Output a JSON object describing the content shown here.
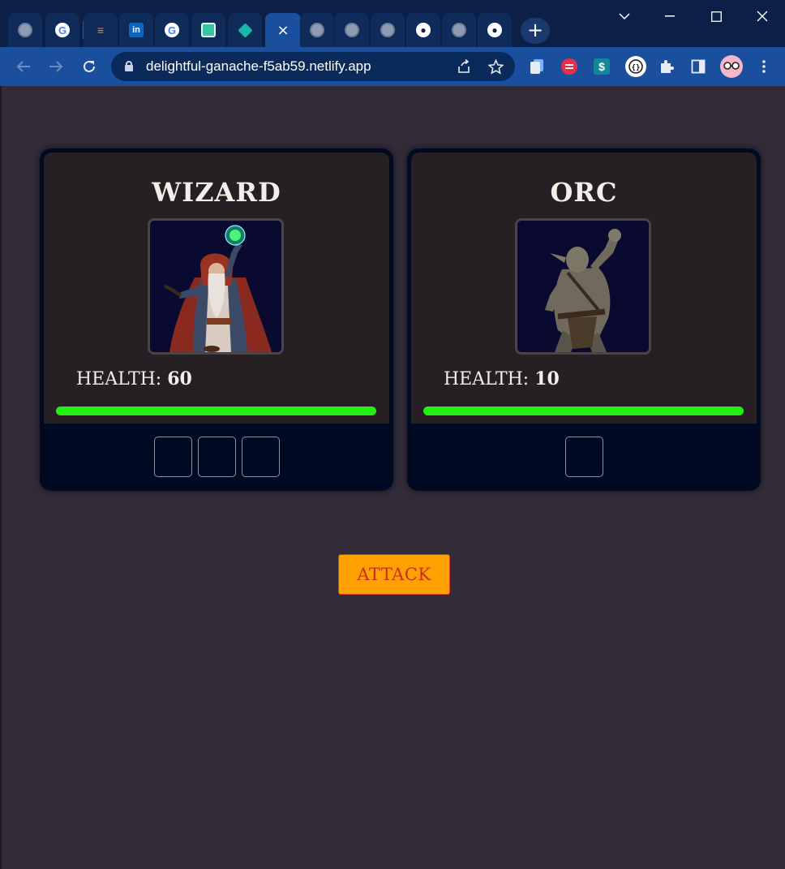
{
  "browser": {
    "tabs": [
      {
        "icon": "globe-icon",
        "glyph": "",
        "active": false
      },
      {
        "icon": "google-icon",
        "glyph": "G",
        "active": false
      },
      {
        "icon": "stackoverflow-icon",
        "glyph": "≡",
        "active": false
      },
      {
        "icon": "linkedin-icon",
        "glyph": "in",
        "active": false
      },
      {
        "icon": "google-icon",
        "glyph": "G",
        "active": false
      },
      {
        "icon": "square-app-icon",
        "glyph": "",
        "active": false
      },
      {
        "icon": "diamond-icon",
        "glyph": "",
        "active": false
      },
      {
        "icon": "close-icon",
        "glyph": "×",
        "active": true
      },
      {
        "icon": "globe-icon",
        "glyph": "",
        "active": false
      },
      {
        "icon": "globe-icon",
        "glyph": "",
        "active": false
      },
      {
        "icon": "globe-icon",
        "glyph": "",
        "active": false
      },
      {
        "icon": "github-icon",
        "glyph": "●",
        "active": false
      },
      {
        "icon": "globe-icon",
        "glyph": "",
        "active": false
      },
      {
        "icon": "github-icon",
        "glyph": "●",
        "active": false
      }
    ],
    "url": "delightful-ganache-f5ab59.netlify.app"
  },
  "game": {
    "players": [
      {
        "name": "WIZARD",
        "health_label": "HEALTH:",
        "health_value": "60",
        "health_fraction": 1.0,
        "dice_count": 3
      },
      {
        "name": "ORC",
        "health_label": "HEALTH:",
        "health_value": "10",
        "health_fraction": 1.0,
        "dice_count": 1
      }
    ],
    "attack_label": "ATTACK"
  },
  "colors": {
    "page_bg": "#322b38",
    "card_bg": "#000a22",
    "card_inner_bg": "#262025",
    "health_bar": "#22ef12",
    "attack_bg": "#ffa100",
    "attack_text": "#c72e1f"
  }
}
